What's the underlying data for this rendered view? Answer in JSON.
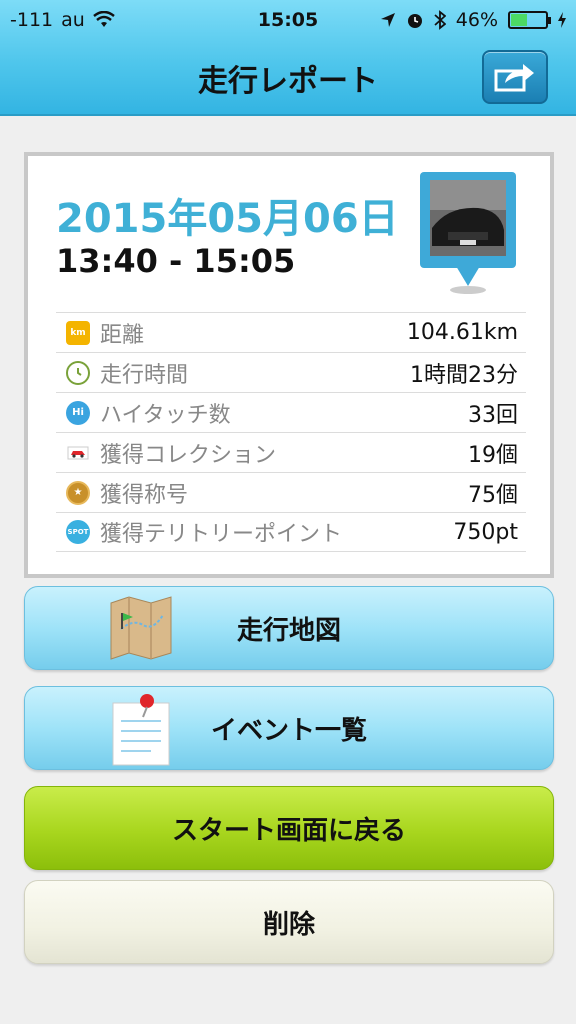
{
  "status_bar": {
    "signal": "-111",
    "carrier": "au",
    "time": "15:05",
    "battery_percent": "46%",
    "battery_level": 0.46
  },
  "nav": {
    "title": "走行レポート",
    "share_icon": "share-icon"
  },
  "report": {
    "date": "2015年05月06日",
    "time_range": "13:40 - 15:05",
    "stats": [
      {
        "icon": "km-icon",
        "label": "距離",
        "value": "104.61km"
      },
      {
        "icon": "clock-icon",
        "label": "走行時間",
        "value": "1時間23分"
      },
      {
        "icon": "hi-touch-icon",
        "label": "ハイタッチ数",
        "value": "33回"
      },
      {
        "icon": "car-icon",
        "label": "獲得コレクション",
        "value": "19個"
      },
      {
        "icon": "medal-icon",
        "label": "獲得称号",
        "value": "75個"
      },
      {
        "icon": "spot-icon",
        "label": "獲得テリトリーポイント",
        "value": "750pt"
      }
    ]
  },
  "buttons": {
    "map": "走行地図",
    "events": "イベント一覧",
    "back_to_start": "スタート画面に戻る",
    "delete": "削除"
  },
  "colors": {
    "accent": "#3fb0d6",
    "header": "#4fc6ec",
    "green_button": "#a8d61e"
  }
}
